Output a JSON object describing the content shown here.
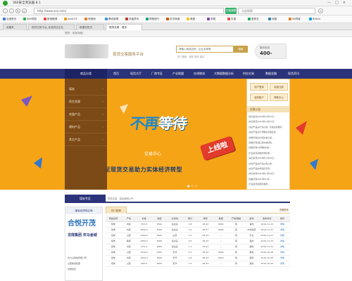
{
  "browser": {
    "title": "360安全浏览器 8.1",
    "url": "http://www.xxx.com/",
    "accelerate": "已极速模式",
    "search_placeholder": "点此搜索",
    "bookmarks": [
      "百度首页",
      "360导航",
      "新浪微博",
      "hao123",
      "淘宝网",
      "腾讯新闻",
      "凤凰资讯",
      "携程旅行",
      "京东商城",
      "美团",
      "网易",
      "天猫",
      "爱奇艺",
      "优酷",
      "58同城",
      "Bilibili"
    ],
    "tabs": [
      {
        "label": "收藏夹",
        "active": false
      },
      {
        "label": "现货交易平台_优选供应企业",
        "active": false
      },
      {
        "label": "新建标签页",
        "active": false
      },
      {
        "label": "现货交易 - 首页",
        "active": true
      }
    ]
  },
  "site": {
    "welcome": "您好，欢迎光临！",
    "slogan": "现货交易服务平台",
    "search_placeholder": "请输入商品名称、企业名称等",
    "search_button": "搜索",
    "search_hint": "热门搜索：煤炭 钢材 建材",
    "phone_label": "服务热线",
    "phone_number": "400-",
    "nav_category": "商品分类",
    "nav": [
      "首页",
      "现货大厅",
      "厂商专区",
      "产业联盟",
      "在线物流",
      "大数据数据分析",
      "供应交易",
      "数据金融",
      "现货资讯"
    ],
    "categories": [
      "煤炭",
      "再生资源",
      "农副产品",
      "建材产品",
      "其它产品"
    ],
    "hero": {
      "line1a": "不再",
      "line1b": "等待",
      "line2": "交易中心",
      "launch": "上线啦",
      "line3": "立足现货交易助力实体经济转型"
    },
    "right_panel": {
      "buttons": [
        "用户登录",
        "免费注册",
        "我的账户",
        "帮助中心"
      ],
      "notice_title": "交易公告",
      "news": [
        "[每日资讯]2016年11月17日...",
        "[每日资讯]2016年11月17日...",
        "[交易产品]关于动力煤、焦炭交易规则...",
        "[交易产品]关于调整交易保证金...",
        "[煤炭行情]动力煤价格小幅...",
        "[煤炭行情]进口煤价格持续...",
        "[煤炭行情]1月钢材价格...",
        "[行业资讯]煤炭市场分析...",
        "[每日资讯]2016年11月15日...",
        "[交易产品]关于动力煤上线...",
        "[交易产品]市场运行平稳...",
        "[每日资讯]2016年11月14日...",
        "[煤炭行情]2016年11月...",
        "[行业资讯]能源局发布..."
      ]
    },
    "section": {
      "title": "煤炭专区",
      "note": "现货交易，信息透明公开",
      "side_title": "煤炭优质供应商",
      "company_logo": "合悦开茂",
      "company2": "龙煤集团  农马金城",
      "company_lines": [
        "合力兴煤炭有限公司",
        "山西焦煤集团",
        "优质供应"
      ],
      "table_tab": "热门推荐",
      "table_more": "查看更多",
      "columns": [
        "商品名称",
        "产地",
        "价格",
        "热值",
        "交货地",
        "硫分",
        "库存",
        "数量",
        "产地/规格",
        "发布",
        "发布时间",
        "操作"
      ],
      "rows": [
        [
          "煤炭",
          "内蒙",
          "555.0",
          "5500",
          "秦皇岛",
          "0.8",
          "28-42",
          "9000",
          "吨",
          "其他",
          "2016-11-15",
          "详情"
        ],
        [
          "煤炭",
          "内蒙",
          "2050.0",
          "5000",
          "秦皇岛",
          "1.0",
          "28-37",
          "9000",
          "吨",
          "中化能源",
          "2016-11-15",
          "详情"
        ],
        [
          "煤炭",
          "山西",
          "1050.0",
          "5500",
          "山西",
          "1.2",
          "28-33",
          "—",
          "吨",
          "天台",
          "2016-11-15",
          "详情"
        ],
        [
          "煤炭",
          "陕西",
          "2050.0",
          "5000",
          "秦皇岛",
          "0.9",
          "28-42",
          "—",
          "吨",
          "其他",
          "2016-11-15",
          "详情"
        ],
        [
          "煤炭",
          "内蒙",
          "970.0",
          "5800",
          "秦皇岛",
          "1.1",
          "22-24",
          "—",
          "吨",
          "其他",
          "2016-11-15",
          "详情"
        ],
        [
          "煤炭",
          "山西",
          "1050.0",
          "5300",
          "天津",
          "0.7",
          "28-33",
          "5000",
          "吨",
          "其他",
          "2016-10-28",
          "详情"
        ],
        [
          "煤炭",
          "内蒙",
          "1000.0",
          "5500",
          "天津",
          "0.8",
          "28-34",
          "9000",
          "吨",
          "其他",
          "2016-10-28",
          "详情"
        ],
        [
          "煤炭",
          "山西",
          "990.0",
          "5000",
          "天津",
          "1.0",
          "28-33",
          "—",
          "吨",
          "其他",
          "2016-10-28",
          "详情"
        ]
      ]
    }
  }
}
